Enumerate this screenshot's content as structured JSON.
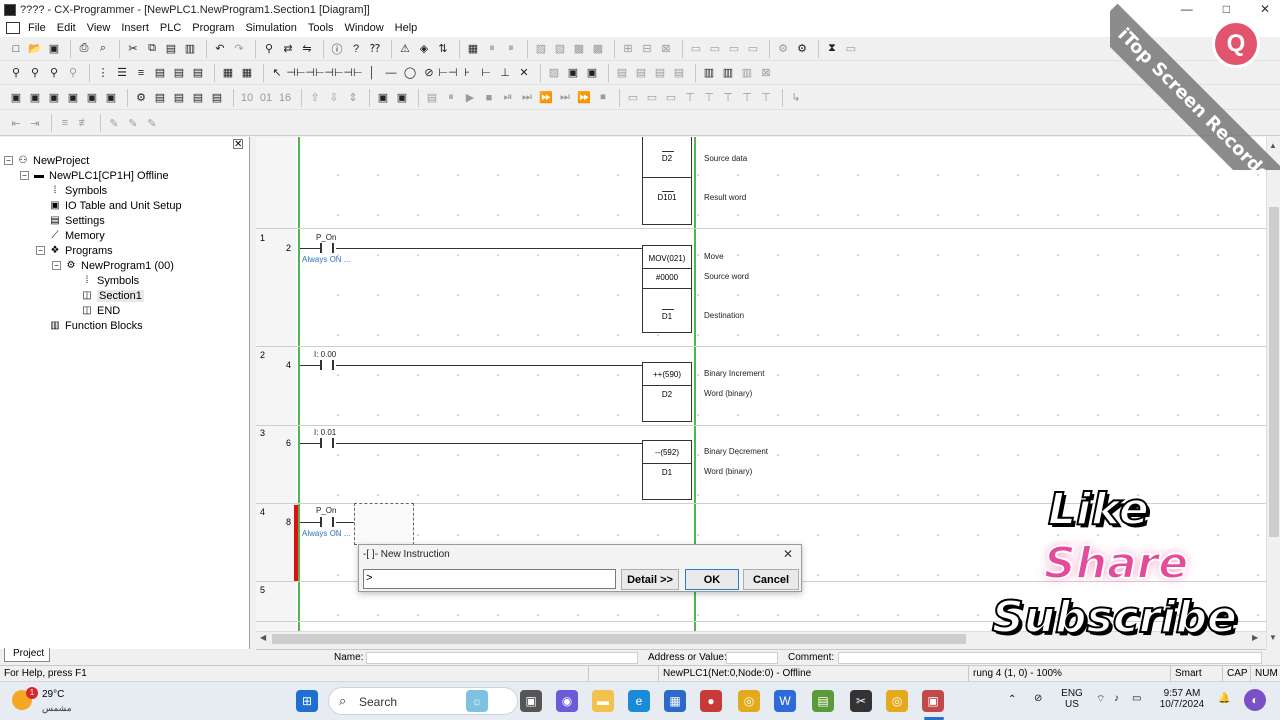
{
  "window": {
    "title": "???? - CX-Programmer - [NewPLC1.NewProgram1.Section1 [Diagram]]",
    "controls": [
      "—",
      "□",
      "✕"
    ]
  },
  "menu": [
    "File",
    "Edit",
    "View",
    "Insert",
    "PLC",
    "Program",
    "Simulation",
    "Tools",
    "Window",
    "Help"
  ],
  "toolbar_icons": {
    "row1": [
      "new-file-icon",
      "open-folder-icon",
      "save-icon",
      "print-icon",
      "cut-icon",
      "copy-icon",
      "paste-icon",
      "undo-icon",
      "redo-icon",
      "find-icon",
      "replace-icon",
      "help-icon",
      "online-icon",
      "transfer-icon"
    ],
    "row2": [
      "zoom-icon",
      "grid-icon",
      "select-icon",
      "contact-no-icon",
      "contact-nc-icon",
      "coil-icon",
      "instruction-icon",
      "line-icon"
    ],
    "row3": [
      "section-icon",
      "compile-icon",
      "run-icon",
      "stop-icon",
      "step-icon"
    ],
    "row4": [
      "outline-icon",
      "comment-icon"
    ]
  },
  "project_tree": [
    {
      "label": "NewProject",
      "level": 0,
      "expander": "−",
      "icon": "project-icon"
    },
    {
      "label": "NewPLC1[CP1H] Offline",
      "level": 1,
      "expander": "−",
      "icon": "plc-icon"
    },
    {
      "label": "Symbols",
      "level": 2,
      "expander": "",
      "icon": "symbols-icon"
    },
    {
      "label": "IO Table and Unit Setup",
      "level": 2,
      "expander": "",
      "icon": "io-table-icon"
    },
    {
      "label": "Settings",
      "level": 2,
      "expander": "",
      "icon": "settings-icon"
    },
    {
      "label": "Memory",
      "level": 2,
      "expander": "",
      "icon": "memory-icon"
    },
    {
      "label": "Programs",
      "level": 2,
      "expander": "−",
      "icon": "programs-icon"
    },
    {
      "label": "NewProgram1 (00)",
      "level": 3,
      "expander": "−",
      "icon": "program-icon"
    },
    {
      "label": "Symbols",
      "level": 4,
      "expander": "",
      "icon": "symbols-icon"
    },
    {
      "label": "Section1",
      "level": 4,
      "expander": "",
      "icon": "section-icon",
      "selected": true
    },
    {
      "label": "END",
      "level": 4,
      "expander": "",
      "icon": "section-icon"
    },
    {
      "label": "Function Blocks",
      "level": 2,
      "expander": "",
      "icon": "function-blocks-icon"
    }
  ],
  "project_tab": "Project",
  "ladder": {
    "top_partial": {
      "operands": [
        "D2",
        "D101"
      ],
      "comments": [
        "Source data",
        "Result word"
      ]
    },
    "rungs": [
      {
        "rung": "1",
        "step": "2",
        "contact": "P_On",
        "contact_comment": "Always ON ...",
        "instruction": "MOV(021)",
        "operands": [
          "#0000",
          "D1"
        ],
        "comments": [
          "Move",
          "Source word",
          "Destination"
        ]
      },
      {
        "rung": "2",
        "step": "4",
        "contact": "I: 0.00",
        "contact_comment": "",
        "instruction": "++(590)",
        "operands": [
          "D2"
        ],
        "comments": [
          "Binary Increment",
          "Word (binary)"
        ]
      },
      {
        "rung": "3",
        "step": "6",
        "contact": "I: 0.01",
        "contact_comment": "",
        "instruction": "--(592)",
        "operands": [
          "D1"
        ],
        "comments": [
          "Binary Decrement",
          "Word (binary)"
        ]
      },
      {
        "rung": "4",
        "step": "8",
        "contact": "P_On",
        "contact_comment": "Always ON ...",
        "instruction": "",
        "operands": [],
        "comments": []
      },
      {
        "rung": "5",
        "step": "",
        "contact": "",
        "contact_comment": "",
        "instruction": "",
        "operands": [],
        "comments": []
      }
    ]
  },
  "dialog": {
    "title": "-[ ]- New Instruction",
    "input_value": ">",
    "detail_label": "Detail >>",
    "ok_label": "OK",
    "cancel_label": "Cancel",
    "close": "✕"
  },
  "info_bar": {
    "name_label": "Name:",
    "address_label": "Address or Value:",
    "comment_label": "Comment:"
  },
  "status_bar": {
    "help": "For Help, press F1",
    "connection": "NewPLC1(Net:0,Node:0) - Offline",
    "position": "rung 4 (1, 0)  - 100%",
    "mode": "Smart",
    "caps": "CAP",
    "num": "NUM"
  },
  "overlay": {
    "like": "Like",
    "share": "Share",
    "subscribe": "Subscribe",
    "recorder": "iTop Screen Recorder"
  },
  "taskbar": {
    "weather_temp": "29°C",
    "weather_cond": "مشمس",
    "weather_badge": "1",
    "search_label": "Search",
    "lang_1": "ENG",
    "lang_2": "US",
    "time": "9:57 AM",
    "date": "10/7/2024"
  }
}
